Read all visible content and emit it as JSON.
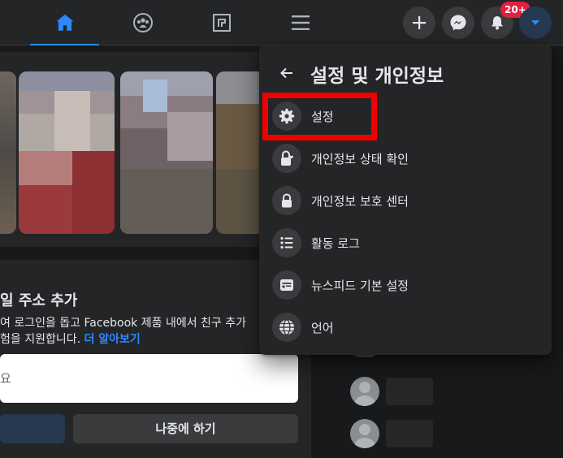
{
  "topbar": {
    "tabs": [
      {
        "name": "home-icon",
        "active": true
      },
      {
        "name": "groups-icon",
        "active": false
      },
      {
        "name": "gaming-icon",
        "active": false
      },
      {
        "name": "menu-icon",
        "active": false
      }
    ],
    "actions": [
      "plus-icon",
      "messenger-icon",
      "bell-icon",
      "caret-down-icon"
    ],
    "notification_badge": "20+"
  },
  "email_card": {
    "title": "일 주소 추가",
    "desc_line1": "여 로그인을 돕고 Facebook 제품 내에서 친구 추가",
    "desc_line2": "험을 지원합니다.",
    "learn_more": "더 알아보기",
    "input_placeholder": "요",
    "later_button": "나중에 하기"
  },
  "menu": {
    "title": "설정 및 개인정보",
    "items": [
      {
        "label": "설정",
        "icon": "gear-icon"
      },
      {
        "label": "개인정보 상태 확인",
        "icon": "lock-heart-icon"
      },
      {
        "label": "개인정보 보호 센터",
        "icon": "lock-icon"
      },
      {
        "label": "활동 로그",
        "icon": "list-icon"
      },
      {
        "label": "뉴스피드 기본 설정",
        "icon": "feed-icon"
      },
      {
        "label": "언어",
        "icon": "globe-icon"
      }
    ]
  },
  "colors": {
    "accent": "#2d88ff",
    "highlight": "#f00000",
    "badge": "#e41e3f",
    "surface": "#242526",
    "background": "#18191a"
  }
}
